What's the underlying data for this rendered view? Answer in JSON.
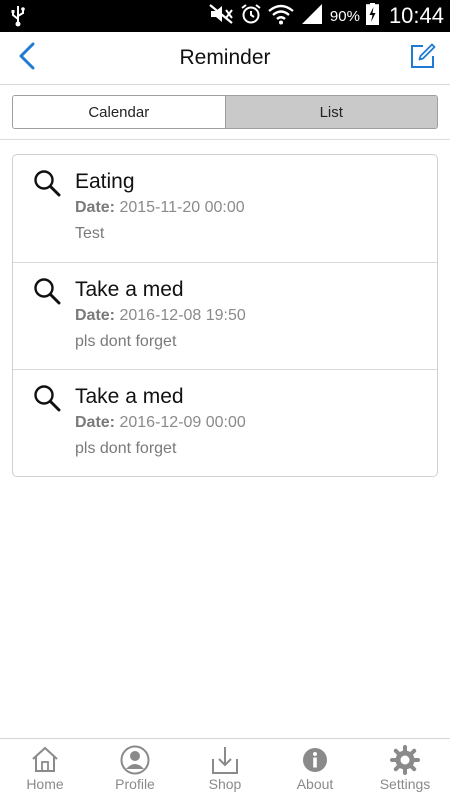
{
  "status_bar": {
    "battery_percent": "90%",
    "clock": "10:44",
    "icons": [
      "usb-icon",
      "mute-icon",
      "alarm-icon",
      "wifi-icon",
      "signal-icon",
      "battery-charging-icon"
    ]
  },
  "header": {
    "title": "Reminder",
    "back_icon": "chevron-left-icon",
    "compose_icon": "compose-icon",
    "accent_color": "#1f7ad3"
  },
  "segment": {
    "tabs": [
      {
        "label": "Calendar",
        "selected": false
      },
      {
        "label": "List",
        "selected": true
      }
    ]
  },
  "reminders": [
    {
      "title": "Eating",
      "date_label": "Date:",
      "date": "2015-11-20 00:00",
      "note": "Test",
      "icon": "search-icon"
    },
    {
      "title": "Take a med",
      "date_label": "Date:",
      "date": "2016-12-08 19:50",
      "note": "pls dont forget",
      "icon": "search-icon"
    },
    {
      "title": "Take a med",
      "date_label": "Date:",
      "date": "2016-12-09 00:00",
      "note": "pls dont forget",
      "icon": "search-icon"
    }
  ],
  "tab_bar": {
    "items": [
      {
        "label": "Home",
        "icon": "home-icon"
      },
      {
        "label": "Profile",
        "icon": "profile-icon"
      },
      {
        "label": "Shop",
        "icon": "download-icon"
      },
      {
        "label": "About",
        "icon": "info-icon"
      },
      {
        "label": "Settings",
        "icon": "gear-icon"
      }
    ]
  }
}
